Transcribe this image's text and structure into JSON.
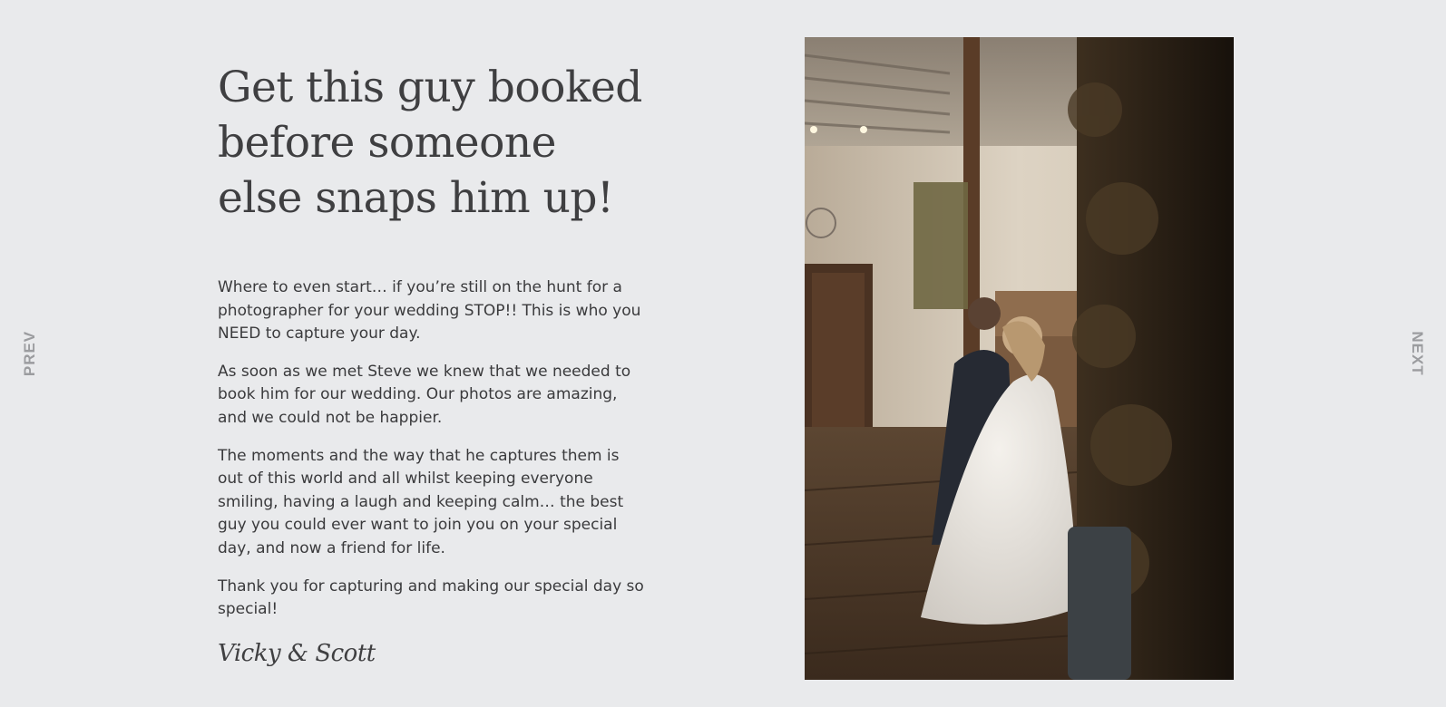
{
  "nav": {
    "prev_label": "PREV",
    "next_label": "NEXT"
  },
  "testimonial": {
    "headline": "Get this guy booked before someone else snaps him up!",
    "paragraphs": [
      "Where to even start… if you’re still on the hunt for a photographer for your wedding STOP!! This is who you NEED to capture your day.",
      "As soon as we met Steve we knew that we needed to book him for our wedding. Our photos are amazing, and we could not be happier.",
      "The moments and the way that he captures them is out of this world and all whilst keeping everyone smiling, having a laugh and keeping calm… the best guy you could ever want to join you on your special day, and now a friend for life.",
      "Thank you for capturing and making our special day so special!"
    ],
    "signature": "Vicky & Scott"
  },
  "colors": {
    "background": "#e9eaec",
    "text": "#3b3b3d",
    "nav_text": "#9b9c9f"
  },
  "icons": {
    "photo": "wedding-couple-photo"
  }
}
